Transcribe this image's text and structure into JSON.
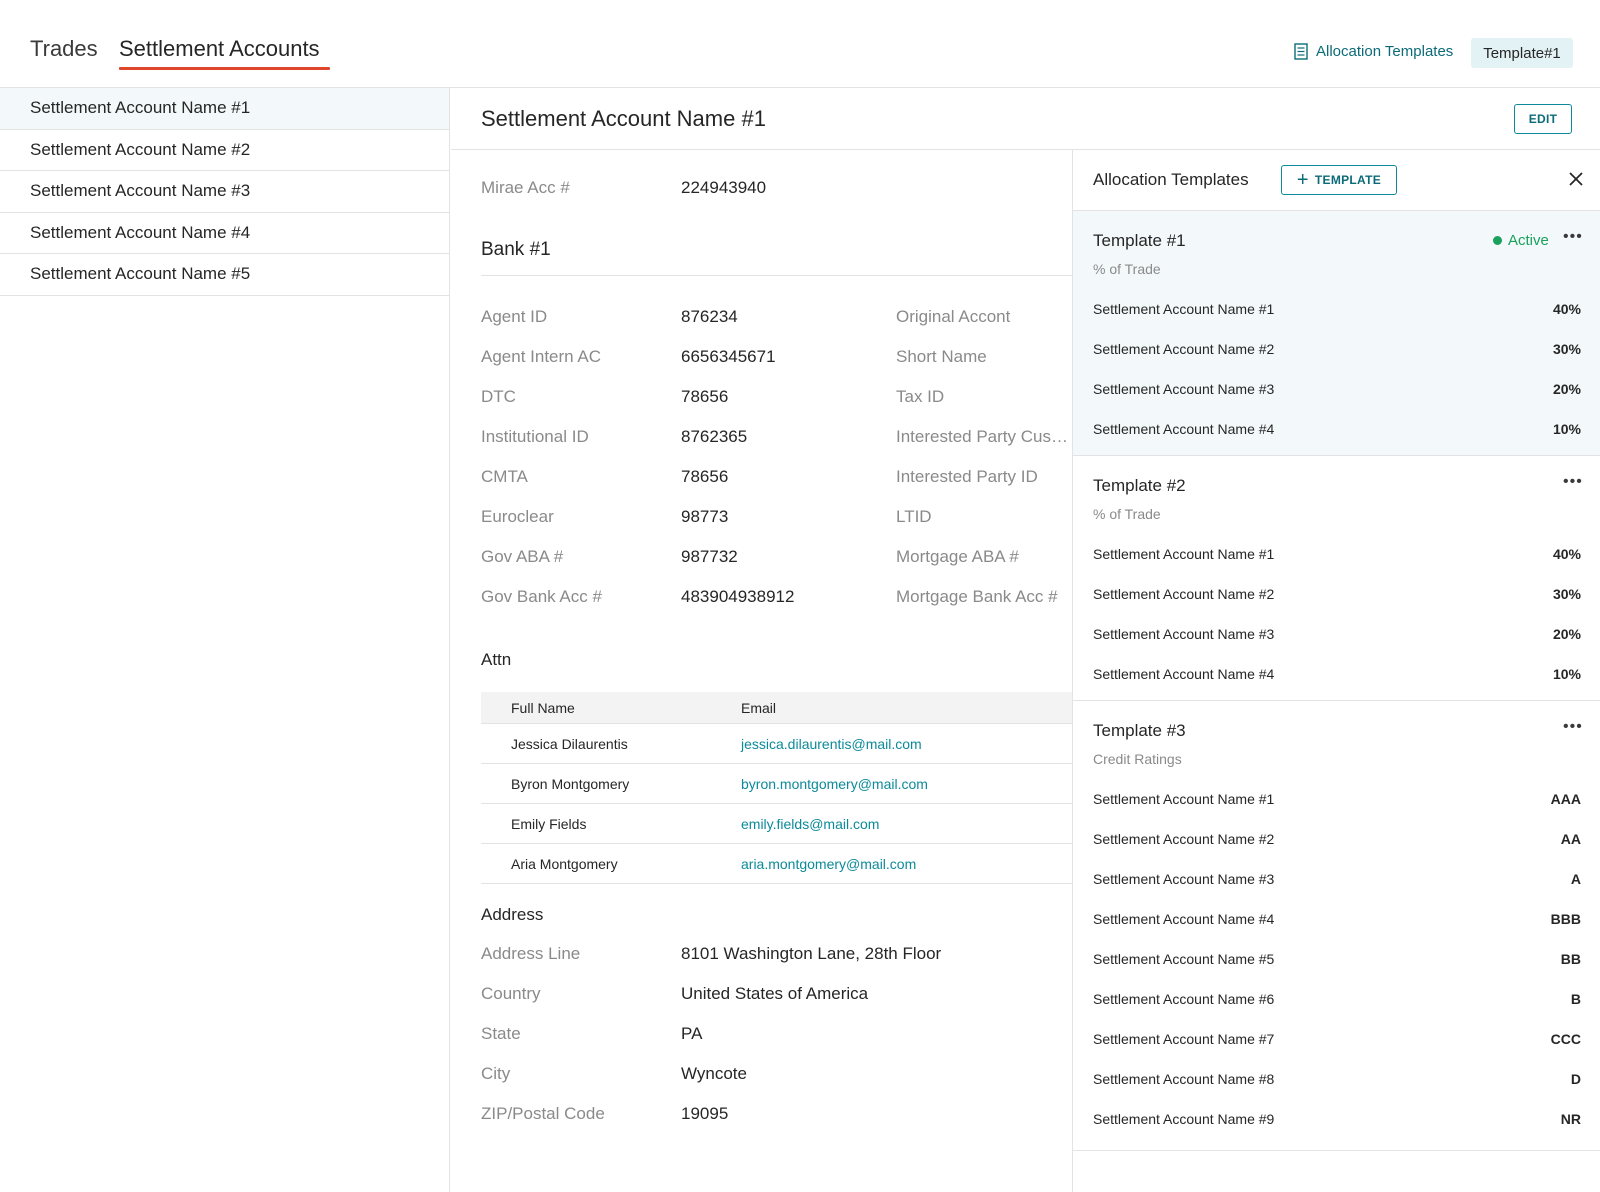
{
  "nav": {
    "tabs": [
      "Trades",
      "Settlement Accounts"
    ],
    "allocation_link": "Allocation Templates",
    "current_template": "Template#1"
  },
  "sidebar": {
    "items": [
      "Settlement Account Name #1",
      "Settlement Account Name #2",
      "Settlement Account Name #3",
      "Settlement Account Name #4",
      "Settlement Account Name #5"
    ]
  },
  "detail": {
    "title": "Settlement Account Name #1",
    "edit_label": "EDIT",
    "mirae_label": "Mirae Acc #",
    "mirae_value": "224943940",
    "bank_title": "Bank #1",
    "bank_fields": [
      {
        "label": "Agent ID",
        "value": "876234"
      },
      {
        "label": "Agent Intern AC",
        "value": "6656345671"
      },
      {
        "label": "DTC",
        "value": "78656"
      },
      {
        "label": "Institutional ID",
        "value": "8762365"
      },
      {
        "label": "CMTA",
        "value": "78656"
      },
      {
        "label": "Euroclear",
        "value": "98773"
      },
      {
        "label": "Gov ABA #",
        "value": "987732"
      },
      {
        "label": "Gov Bank Acc #",
        "value": "483904938912"
      }
    ],
    "bank_fields_right": [
      "Original Accont",
      "Short Name",
      "Tax ID",
      "Interested Party Custodian",
      "Interested Party ID",
      "LTID",
      "Mortgage ABA #",
      "Mortgage Bank Acc #"
    ],
    "attn_title": "Attn",
    "attn_headers": {
      "name": "Full Name",
      "email": "Email"
    },
    "attn_rows": [
      {
        "name": "Jessica Dilaurentis",
        "email": "jessica.dilaurentis@mail.com"
      },
      {
        "name": "Byron Montgomery",
        "email": "byron.montgomery@mail.com"
      },
      {
        "name": "Emily Fields",
        "email": "emily.fields@mail.com"
      },
      {
        "name": "Aria Montgomery",
        "email": "aria.montgomery@mail.com"
      }
    ],
    "address_title": "Address",
    "address_fields": [
      {
        "label": "Address Line",
        "value": "8101 Washington Lane, 28th Floor"
      },
      {
        "label": "Country",
        "value": "United States of America"
      },
      {
        "label": "State",
        "value": "PA"
      },
      {
        "label": "City",
        "value": "Wyncote"
      },
      {
        "label": "ZIP/Postal Code",
        "value": "19095"
      }
    ]
  },
  "panel": {
    "title": "Allocation Templates",
    "add_label": "TEMPLATE",
    "templates": [
      {
        "name": "Template #1",
        "subtitle": "% of Trade",
        "status": "Active",
        "rows": [
          {
            "account": "Settlement Account Name #1",
            "value": "40%"
          },
          {
            "account": "Settlement Account Name #2",
            "value": "30%"
          },
          {
            "account": "Settlement Account Name #3",
            "value": "20%"
          },
          {
            "account": "Settlement Account Name #4",
            "value": "10%"
          }
        ]
      },
      {
        "name": "Template #2",
        "subtitle": "% of Trade",
        "status": "",
        "rows": [
          {
            "account": "Settlement Account Name #1",
            "value": "40%"
          },
          {
            "account": "Settlement Account Name #2",
            "value": "30%"
          },
          {
            "account": "Settlement Account Name #3",
            "value": "20%"
          },
          {
            "account": "Settlement Account Name #4",
            "value": "10%"
          }
        ]
      },
      {
        "name": "Template #3",
        "subtitle": "Credit Ratings",
        "status": "",
        "rows": [
          {
            "account": "Settlement Account Name #1",
            "value": "AAA"
          },
          {
            "account": "Settlement Account Name #2",
            "value": "AA"
          },
          {
            "account": "Settlement Account Name #3",
            "value": "A"
          },
          {
            "account": "Settlement Account Name #4",
            "value": "BBB"
          },
          {
            "account": "Settlement Account Name #5",
            "value": "BB"
          },
          {
            "account": "Settlement Account Name #6",
            "value": "B"
          },
          {
            "account": "Settlement Account Name #7",
            "value": "CCC"
          },
          {
            "account": "Settlement Account Name #8",
            "value": "D"
          },
          {
            "account": "Settlement Account Name #9",
            "value": "NR"
          }
        ]
      }
    ]
  },
  "colors": {
    "accent": "#0c8a9a",
    "tab_underline": "#e0462b",
    "active_status": "#1aa15c",
    "selected_bg": "#f3f9fb"
  }
}
